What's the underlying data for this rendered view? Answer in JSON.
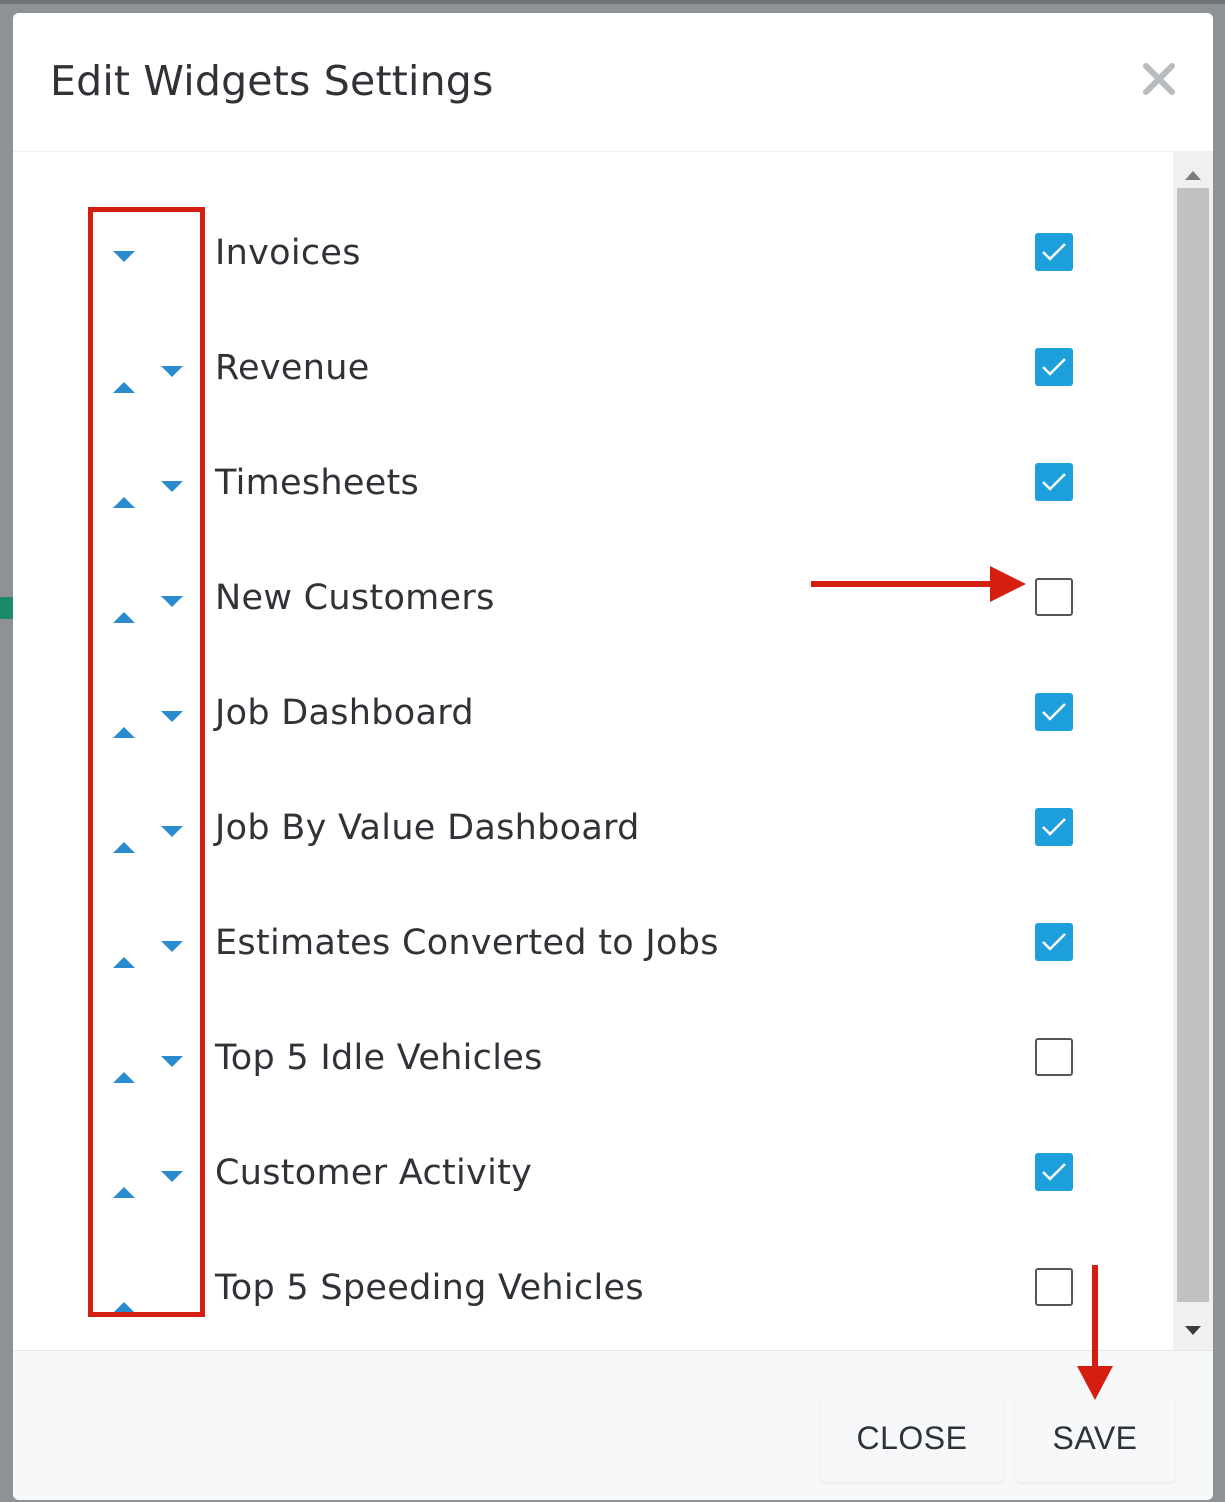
{
  "modal": {
    "title": "Edit Widgets Settings",
    "close_icon": "close-icon"
  },
  "widgets": [
    {
      "label": "Invoices",
      "checked": true
    },
    {
      "label": "Revenue",
      "checked": true
    },
    {
      "label": "Timesheets",
      "checked": true
    },
    {
      "label": "New Customers",
      "checked": false
    },
    {
      "label": "Job Dashboard",
      "checked": true
    },
    {
      "label": "Job By Value Dashboard",
      "checked": true
    },
    {
      "label": "Estimates Converted to Jobs",
      "checked": true
    },
    {
      "label": "Top 5 Idle Vehicles",
      "checked": false
    },
    {
      "label": "Customer Activity",
      "checked": true
    },
    {
      "label": "Top 5 Speeding Vehicles",
      "checked": false
    }
  ],
  "footer": {
    "close_label": "CLOSE",
    "save_label": "SAVE"
  },
  "colors": {
    "accent": "#1d9fdc",
    "annotation": "#d41f10",
    "text": "#2f3337"
  }
}
